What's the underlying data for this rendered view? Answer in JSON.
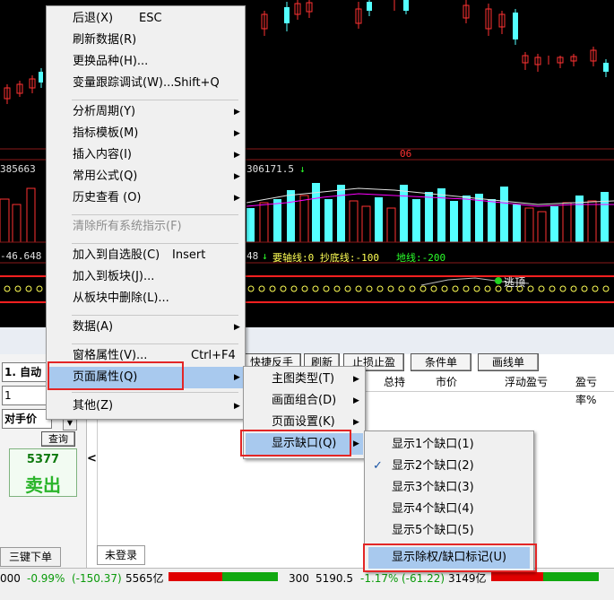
{
  "chart": {
    "top_text_left": "385663",
    "top_text_mid": "306171.5",
    "top_text_arrow": "↓",
    "date_label": "06",
    "indicator_prefix": "-46.648",
    "indicator_prefix2": "48",
    "indicator_arrow": "↓",
    "indicator_line": "要轴线:0  抄底线:-100",
    "indicator_green": "地线:-200",
    "escape_label": "逃顶"
  },
  "menu_main": {
    "items": [
      {
        "label": "后退(X)",
        "shortcut": "ESC"
      },
      {
        "label": "刷新数据(R)"
      },
      {
        "label": "更换品种(H)..."
      },
      {
        "label": "变量跟踪调试(W)...",
        "shortcut": "Shift+Q"
      },
      {
        "label": "分析周期(Y)",
        "submenu": true
      },
      {
        "label": "指标模板(M)",
        "submenu": true
      },
      {
        "label": "插入内容(I)",
        "submenu": true
      },
      {
        "label": "常用公式(Q)",
        "submenu": true
      },
      {
        "label": "历史查看 (O)",
        "submenu": true
      },
      {
        "label": "清除所有系统指示(F)",
        "disabled": true
      },
      {
        "label": "加入到自选股(C)",
        "shortcut": "Insert"
      },
      {
        "label": "加入到板块(J)..."
      },
      {
        "label": "从板块中删除(L)..."
      },
      {
        "label": "数据(A)",
        "submenu": true
      },
      {
        "label": "窗格属性(V)...",
        "shortcut": "Ctrl+F4"
      },
      {
        "label": "页面属性(Q)",
        "submenu": true,
        "highlighted": true
      },
      {
        "label": "其他(Z)",
        "submenu": true
      }
    ]
  },
  "menu_page": {
    "items": [
      {
        "label": "主图类型(T)",
        "submenu": true
      },
      {
        "label": "画面组合(D)",
        "submenu": true
      },
      {
        "label": "页面设置(K)",
        "submenu": true
      },
      {
        "label": "显示缺口(Q)",
        "submenu": true,
        "highlighted": true
      }
    ]
  },
  "menu_gap": {
    "items": [
      {
        "label": "显示1个缺口(1)"
      },
      {
        "label": "显示2个缺口(2)",
        "checked": true
      },
      {
        "label": "显示3个缺口(3)"
      },
      {
        "label": "显示4个缺口(4)"
      },
      {
        "label": "显示5个缺口(5)"
      },
      {
        "label": "显示除权/缺口标记(U)",
        "highlighted": true
      }
    ],
    "check_mark": "✓"
  },
  "trade": {
    "mode_select": "1. 自动",
    "qty_value": "1",
    "price_select": "对手价",
    "query_button": "查询",
    "sell_price": "5377",
    "sell_label": "卖出",
    "quick_button": "快捷反手",
    "refresh_button": "刷新",
    "stoploss_button": "止损止盈",
    "condition_button": "条件单",
    "drawline_button": "画线单",
    "columns": [
      "总持",
      "市价",
      "浮动盈亏",
      "盈亏率%"
    ],
    "three_key_tab": "三键下单",
    "not_logged_tab": "未登录",
    "collapse_arrow": "<"
  },
  "status": {
    "left_index": "000",
    "left_change": "-0.99%",
    "left_change_abs": "(-150.37)",
    "left_volume": "5565亿",
    "right_index": "300",
    "right_price": "5190.5",
    "right_change": "-1.17%",
    "right_change_abs": "(-61.22)",
    "right_volume": "3149亿"
  },
  "colors": {
    "up": "#ff3232",
    "down": "#54ffff",
    "highlight": "#a8c9ee",
    "annotation_red": "#e32626",
    "green_text": "#2bb52b"
  }
}
